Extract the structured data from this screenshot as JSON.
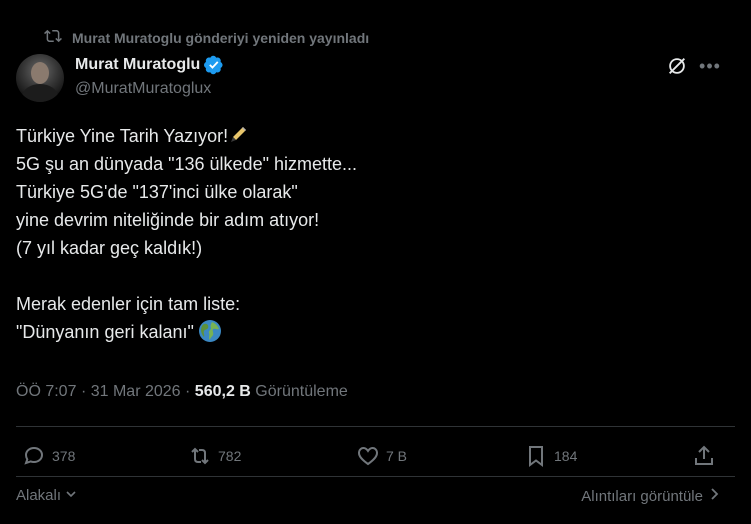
{
  "repost": {
    "text": "Murat Muratoglu gönderiyi yeniden yayınladı"
  },
  "author": {
    "display_name": "Murat Muratoglu",
    "handle": "@MuratMuratoglux",
    "verified": true
  },
  "tweet": {
    "lines": [
      "Türkiye Yine Tarih Yazıyor!",
      "5G şu an dünyada \"136 ülkede\" hizmette...",
      "Türkiye 5G'de \"137'inci ülke olarak\"",
      "yine devrim niteliğinde bir adım atıyor!",
      "(7 yıl kadar geç kaldık!)",
      "",
      "Merak edenler için tam liste:",
      "\"Dünyanın geri kalanı\""
    ],
    "emojis": {
      "line1": "pen-emoji",
      "line8": "globe-emoji"
    }
  },
  "meta": {
    "time": "ÖÖ 7:07",
    "date": "31 Mar 2026",
    "separator": "·",
    "views_count": "560,2 B",
    "views_label": "Görüntüleme"
  },
  "actions": {
    "replies": "378",
    "reposts": "782",
    "likes": "7 B",
    "bookmarks": "184"
  },
  "footer": {
    "sort_label": "Alakalı",
    "quotes_label": "Alıntıları görüntüle"
  },
  "icons": [
    "repost-icon",
    "verified-badge-icon",
    "grok-icon",
    "more-icon",
    "reply-icon",
    "repost-icon",
    "like-icon",
    "bookmark-icon",
    "share-icon",
    "chevron-down-icon",
    "chevron-right-icon"
  ],
  "colors": {
    "background": "#000000",
    "text": "#e7e9ea",
    "muted": "#71767b",
    "verified": "#1d9bf0",
    "divider": "#2f3336"
  }
}
